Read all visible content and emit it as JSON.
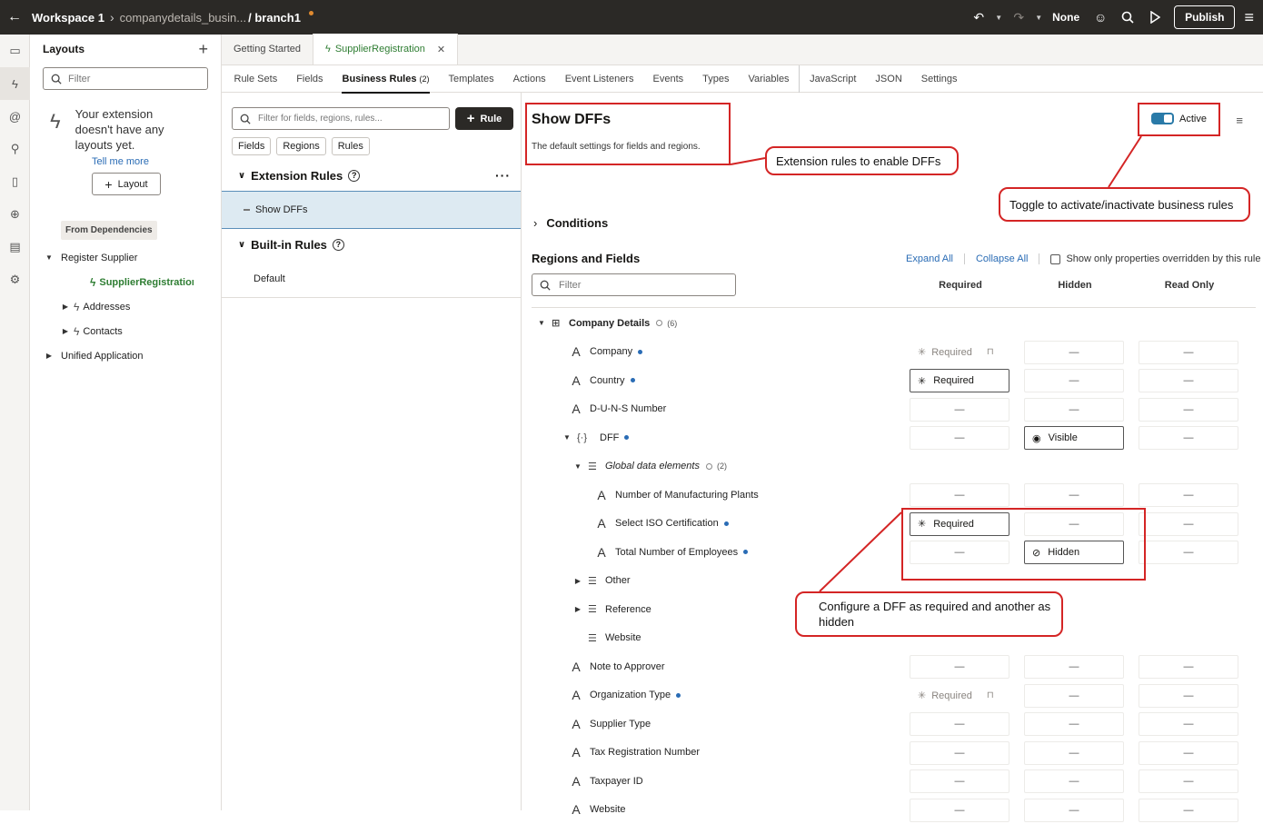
{
  "topbar": {
    "workspace": "Workspace 1",
    "project": "companydetails_busin...",
    "branch": "/ branch1",
    "none_label": "None",
    "publish": "Publish"
  },
  "layouts": {
    "title": "Layouts",
    "filter_placeholder": "Filter",
    "empty_text": "Your extension doesn't have any layouts yet.",
    "tell_me_more": "Tell me more",
    "layout_button": "Layout",
    "from_dependencies": "From Dependencies",
    "tree": [
      {
        "label": "Register Supplier",
        "level": 0,
        "caret": "down"
      },
      {
        "label": "SupplierRegistration",
        "level": 2,
        "caret": "",
        "selected": true
      },
      {
        "label": "Addresses",
        "level": 1,
        "caret": "right"
      },
      {
        "label": "Contacts",
        "level": 1,
        "caret": "right"
      },
      {
        "label": "Unified Application",
        "level": 0,
        "caret": "right"
      }
    ]
  },
  "tabs": {
    "getting_started": "Getting Started",
    "supplier_registration": "SupplierRegistration"
  },
  "subtabs": [
    {
      "label": "Rule Sets"
    },
    {
      "label": "Fields"
    },
    {
      "label": "Business Rules",
      "count": "(2)",
      "active": true
    },
    {
      "label": "Templates"
    },
    {
      "label": "Actions"
    },
    {
      "label": "Event Listeners"
    },
    {
      "label": "Events"
    },
    {
      "label": "Types"
    },
    {
      "label": "Variables"
    },
    {
      "label": "JavaScript"
    },
    {
      "label": "JSON"
    },
    {
      "label": "Settings"
    }
  ],
  "rules": {
    "filter_placeholder": "Filter for fields, regions, rules...",
    "rule_button": "Rule",
    "chips": [
      "Fields",
      "Regions",
      "Rules"
    ],
    "extension_rules": "Extension Rules",
    "show_dffs": "Show DFFs",
    "builtin_rules": "Built-in Rules",
    "default": "Default"
  },
  "detail": {
    "title": "Show DFFs",
    "subtitle": "The default settings for fields and regions.",
    "active_label": "Active",
    "conditions": "Conditions",
    "regions_fields": "Regions and Fields",
    "expand_all": "Expand All",
    "collapse_all": "Collapse All",
    "overridden": "Show only properties overridden by this rule",
    "filter_placeholder": "Filter",
    "col_required": "Required",
    "col_hidden": "Hidden",
    "col_readonly": "Read Only"
  },
  "callouts": {
    "ext": "Extension rules to enable DFFs",
    "toggle": "Toggle to activate/inactivate business rules",
    "configure": "Configure a DFF as required and another as hidden"
  },
  "rows": [
    {
      "label": "Company Details",
      "type": "region",
      "indent": 0,
      "caret": "down",
      "count": "(6)"
    },
    {
      "label": "Company",
      "type": "field",
      "indent": 1,
      "dot": true,
      "req": "Required",
      "req_state": "readonly",
      "hid": "—",
      "ro": "—"
    },
    {
      "label": "Country",
      "type": "field",
      "indent": 1,
      "dot": true,
      "req": "Required",
      "req_state": "on",
      "hid": "—",
      "ro": "—"
    },
    {
      "label": "D-U-N-S Number",
      "type": "field",
      "indent": 1,
      "req": "—",
      "hid": "—",
      "ro": "—"
    },
    {
      "label": "DFF",
      "type": "dff",
      "indent": 1,
      "caret": "down",
      "dot": true,
      "req": "—",
      "hid": "Visible",
      "hid_state": "on",
      "ro": "—"
    },
    {
      "label": "Global data elements",
      "type": "list",
      "indent": 2,
      "caret": "down",
      "count": "(2)",
      "italic": true
    },
    {
      "label": "Number of Manufacturing Plants",
      "type": "field",
      "indent": 3,
      "req": "—",
      "hid": "—",
      "ro": "—"
    },
    {
      "label": "Select ISO Certification",
      "type": "field",
      "indent": 3,
      "dot": true,
      "req": "Required",
      "req_state": "on",
      "hid": "—",
      "ro": "—"
    },
    {
      "label": "Total Number of Employees",
      "type": "field",
      "indent": 3,
      "dot": true,
      "req": "—",
      "hid": "Hidden",
      "hid_state": "on",
      "ro": "—"
    },
    {
      "label": "Other",
      "type": "list",
      "indent": 2,
      "caret": "right"
    },
    {
      "label": "Reference",
      "type": "list",
      "indent": 2,
      "caret": "right"
    },
    {
      "label": "Website",
      "type": "list",
      "indent": 2
    },
    {
      "label": "Note to Approver",
      "type": "field",
      "indent": 1,
      "req": "—",
      "hid": "—",
      "ro": "—"
    },
    {
      "label": "Organization Type",
      "type": "field",
      "indent": 1,
      "dot": true,
      "req": "Required",
      "req_state": "readonly",
      "hid": "—",
      "ro": "—"
    },
    {
      "label": "Supplier Type",
      "type": "field",
      "indent": 1,
      "req": "—",
      "hid": "—",
      "ro": "—"
    },
    {
      "label": "Tax Registration Number",
      "type": "field",
      "indent": 1,
      "req": "—",
      "hid": "—",
      "ro": "—"
    },
    {
      "label": "Taxpayer ID",
      "type": "field",
      "indent": 1,
      "req": "—",
      "hid": "—",
      "ro": "—"
    },
    {
      "label": "Website",
      "type": "field",
      "indent": 1,
      "req": "—",
      "hid": "—",
      "ro": "—"
    }
  ]
}
